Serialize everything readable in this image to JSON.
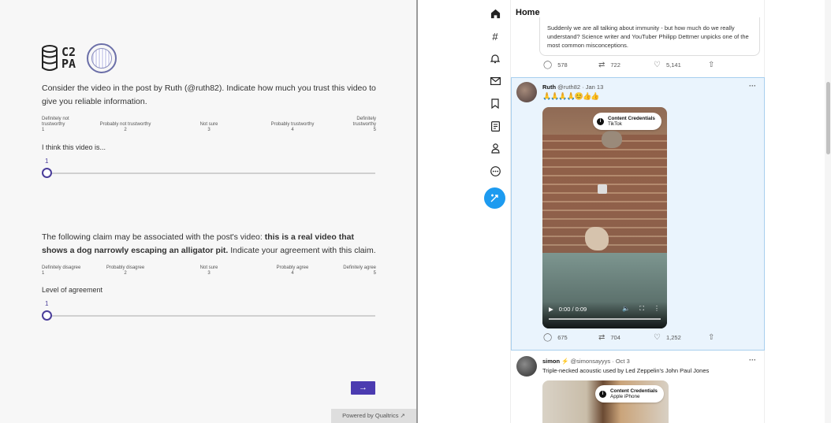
{
  "survey": {
    "logo_c2pa_line1": "C2",
    "logo_c2pa_line2": "PA",
    "q1": {
      "text": "Consider the video in the post by Ruth (@ruth82). Indicate how much you trust this video to give you reliable information.",
      "scale": [
        {
          "line1": "Definitely not",
          "line2": "trustworthy",
          "num": "1"
        },
        {
          "line1": "",
          "line2": "Probably not trustworthy",
          "num": "2"
        },
        {
          "line1": "",
          "line2": "Not sure",
          "num": "3"
        },
        {
          "line1": "",
          "line2": "Probably trustworthy",
          "num": "4"
        },
        {
          "line1": "Definitely",
          "line2": "trustworthy",
          "num": "5"
        }
      ],
      "slider_label": "I think this video is...",
      "slider_value": "1"
    },
    "q2": {
      "text_prefix": "The following claim may be associated with the post's video: ",
      "text_bold": "this is a real video that shows a dog narrowly escaping an alligator pit.",
      "text_suffix": " Indicate your agreement with this claim.",
      "scale": [
        {
          "line2": "Definitely disagree",
          "num": "1"
        },
        {
          "line2": "Probably disagree",
          "num": "2"
        },
        {
          "line2": "Not sure",
          "num": "3"
        },
        {
          "line2": "Probably agree",
          "num": "4"
        },
        {
          "line2": "Definitely agree",
          "num": "5"
        }
      ],
      "slider_label": "Level of agreement",
      "slider_value": "1"
    },
    "next_label": "→",
    "powered_by": "Powered by Qualtrics ↗"
  },
  "twitter": {
    "home_title": "Home",
    "quoted_text": "Suddenly we are all talking about immunity - but how much do we really understand? Science writer and YouTuber Philipp Dettmer unpicks one of the most common misconceptions.",
    "prev_actions": {
      "replies": "578",
      "retweets": "722",
      "likes": "5,141"
    },
    "post1": {
      "name": "Ruth",
      "handle_date": "@ruth82 · Jan 13",
      "emoji": "🙏🙏🙏🙏😊👍👍",
      "cred_title": "Content Credentials",
      "cred_source": "TikTok",
      "video_time": "0:00 / 0:09",
      "actions": {
        "replies": "675",
        "retweets": "704",
        "likes": "1,252"
      }
    },
    "post2": {
      "name": "simon",
      "handle_date": "@simonsayyys · Oct 3",
      "text": "Triple-necked acoustic used by Led Zeppelin's John Paul Jones",
      "cred_title": "Content Credentials",
      "cred_source": "Apple iPhone"
    },
    "more_label": "···"
  }
}
